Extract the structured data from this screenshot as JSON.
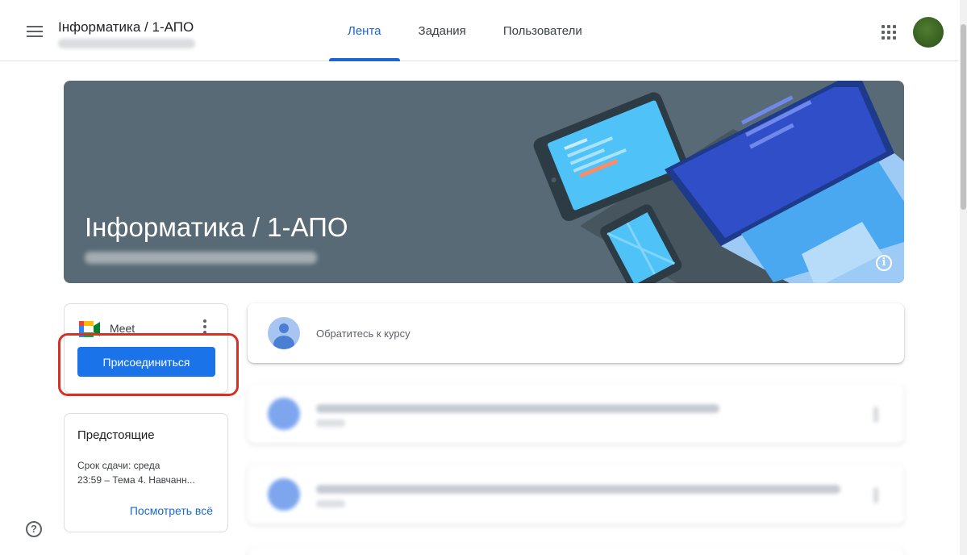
{
  "header": {
    "course_title": "Інформатика / 1-АПО",
    "tabs": [
      {
        "label": "Лента",
        "active": true
      },
      {
        "label": "Задания",
        "active": false
      },
      {
        "label": "Пользователи",
        "active": false
      }
    ],
    "icons": [
      "menu-icon",
      "apps-grid-icon",
      "avatar"
    ]
  },
  "banner": {
    "title": "Інформатика / 1-АПО",
    "background_color": "#586a75"
  },
  "meet": {
    "label": "Meet",
    "join_label": "Присоединиться",
    "highlight_color": "#d93025"
  },
  "upcoming": {
    "title": "Предстоящие",
    "due": "Срок сдачи: среда",
    "item": "23:59 – Тема 4. Навчанн...",
    "view_all": "Посмотреть всё"
  },
  "stream": {
    "announce_placeholder": "Обратитесь к курсу"
  },
  "colors": {
    "accent": "#1967d2",
    "button": "#1a73e8"
  }
}
